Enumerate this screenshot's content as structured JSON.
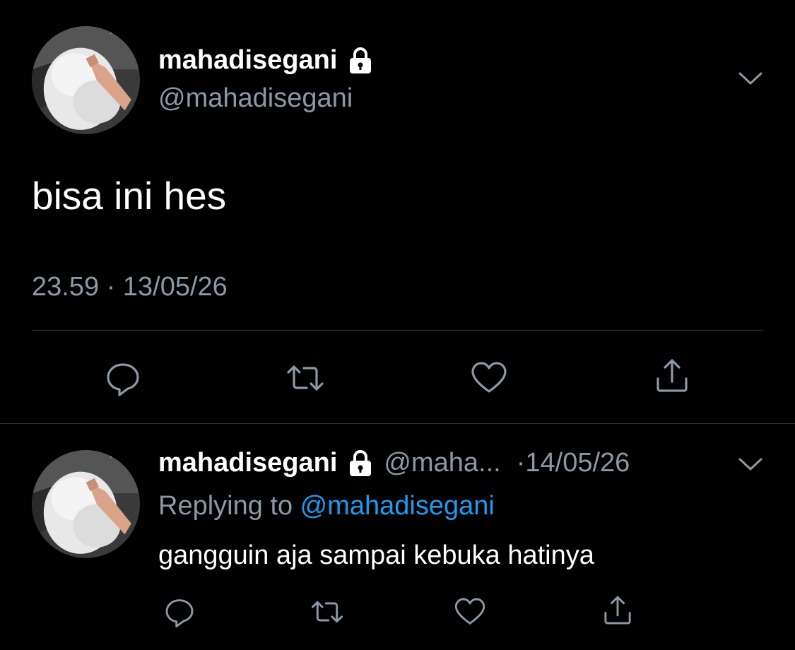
{
  "colors": {
    "background": "#000000",
    "primary_text": "#ffffff",
    "secondary_text": "#8b98a5",
    "link": "#1d9bf0",
    "divider": "#2f3336"
  },
  "main_tweet": {
    "display_name": "mahadisegani",
    "protected_icon": "lock-icon",
    "handle": "@mahadisegani",
    "text": "bisa ini hes",
    "timestamp": "23.59 · 13/05/26",
    "actions": [
      "reply-icon",
      "retweet-icon",
      "like-icon",
      "share-icon"
    ]
  },
  "reply_tweet": {
    "display_name": "mahadisegani",
    "protected_icon": "lock-icon",
    "handle": "@maha...",
    "date": "·14/05/26",
    "replying_prefix": "Replying to ",
    "replying_mention": "@mahadisegani",
    "text": "gangguin aja sampai kebuka hatinya",
    "actions": [
      "reply-icon",
      "retweet-icon",
      "like-icon",
      "share-icon"
    ]
  }
}
